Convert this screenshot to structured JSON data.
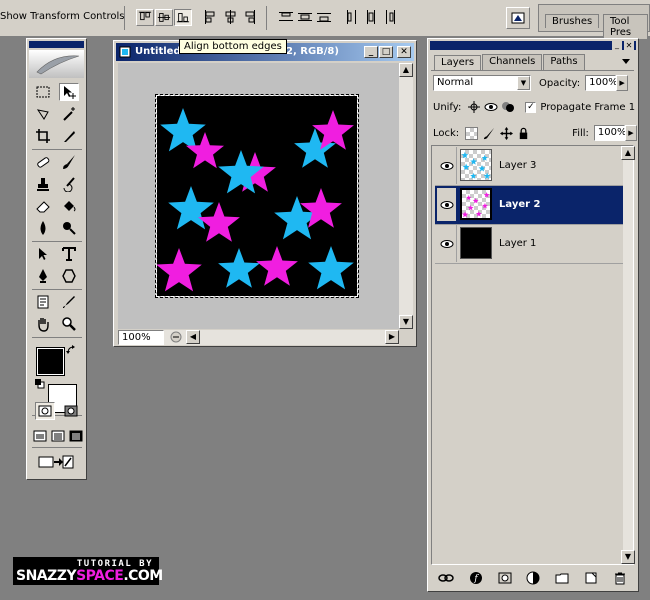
{
  "options_bar": {
    "show_transform_label": "Show Transform Controls",
    "palette_tabs": [
      "Brushes",
      "Tool Pres"
    ]
  },
  "tooltip": {
    "text": "Align bottom edges"
  },
  "document": {
    "title_left": "Untitled",
    "title_right": "2, RGB/8)",
    "zoom": "100%",
    "controls": {
      "minimize": "_",
      "maximize": "□",
      "close": "✕"
    }
  },
  "canvas_stars": {
    "colors": {
      "cyan": "#1fb8f2",
      "magenta": "#f01ee0",
      "background": "#000000"
    },
    "note_stars": [
      {
        "c": "cyan"
      },
      {
        "c": "magenta"
      },
      {
        "c": "magenta"
      },
      {
        "c": "cyan"
      },
      {
        "c": "cyan"
      },
      {
        "c": "magenta"
      },
      {
        "c": "cyan"
      },
      {
        "c": "magenta"
      },
      {
        "c": "cyan"
      },
      {
        "c": "magenta"
      },
      {
        "c": "magenta"
      },
      {
        "c": "cyan"
      },
      {
        "c": "magenta"
      },
      {
        "c": "cyan"
      }
    ]
  },
  "layers_panel": {
    "tabs": [
      {
        "label": "Layers",
        "active": true
      },
      {
        "label": "Channels",
        "active": false
      },
      {
        "label": "Paths",
        "active": false
      }
    ],
    "blend_mode": "Normal",
    "opacity_label": "Opacity:",
    "opacity_value": "100%",
    "unify_label": "Unify:",
    "propagate_label": "Propagate Frame 1",
    "propagate_checked": true,
    "lock_label": "Lock:",
    "fill_label": "Fill:",
    "fill_value": "100%",
    "layers": [
      {
        "name": "Layer 3",
        "selected": false,
        "thumb": "cyan-stars"
      },
      {
        "name": "Layer 2",
        "selected": true,
        "thumb": "magenta-stars"
      },
      {
        "name": "Layer 1",
        "selected": false,
        "thumb": "black"
      }
    ]
  },
  "branding": {
    "line1": "TUTORIAL BY",
    "line2a": "SNAZZY",
    "line2b": "SPACE",
    "line2c": ".COM"
  },
  "colors": {
    "ui_gray": "#d4d0c8",
    "workspace": "#808080",
    "title_blue": "#0a246a",
    "selection_blue": "#0a246a"
  }
}
